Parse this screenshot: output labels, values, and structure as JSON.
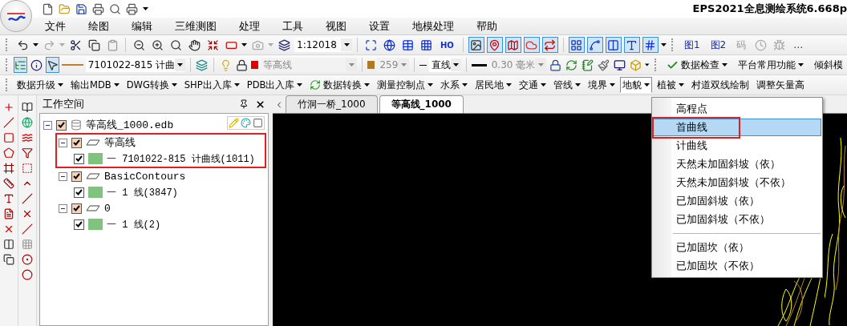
{
  "title": "EPS2021全息测绘系统6.668p",
  "menu": [
    "文件",
    "绘图",
    "编辑",
    "三维测图",
    "处理",
    "工具",
    "视图",
    "设置",
    "地模处理",
    "帮助"
  ],
  "toolbar_standard": {
    "scale": "1:12018",
    "text_button": "HO",
    "view_buttons": [
      "图1",
      "图2"
    ],
    "code_button": {
      "label": "码",
      "disabled": true
    },
    "more": "…"
  },
  "toolbar_properties": {
    "layer_tree_on": true,
    "select_on": true,
    "code": {
      "value": "7101022-815 计曲",
      "disabled": false
    },
    "layer": {
      "value": "等高线",
      "disabled": true
    },
    "color_index": {
      "value": "259",
      "disabled": true
    },
    "line_type": {
      "value": "直线",
      "disabled": false
    },
    "line_width": {
      "value": "0.30 毫米",
      "disabled": true
    },
    "menus": [
      "数据检查",
      "平台常用功能",
      "倾斜模"
    ]
  },
  "toolbar_modules": [
    {
      "label": "数据升级",
      "open": false
    },
    {
      "label": "输出MDB",
      "open": false
    },
    {
      "label": "DWG转换",
      "open": false
    },
    {
      "label": "SHP出入库",
      "open": false
    },
    {
      "label": "PDB出入库",
      "open": false
    },
    {
      "label": "数据转换",
      "open": false
    },
    {
      "label": "测量控制点",
      "open": false
    },
    {
      "label": "水系",
      "open": false
    },
    {
      "label": "居民地",
      "open": false
    },
    {
      "label": "交通",
      "open": false
    },
    {
      "label": "管线",
      "open": false
    },
    {
      "label": "境界",
      "open": false
    },
    {
      "label": "地貌",
      "open": true
    },
    {
      "label": "植被",
      "open": false
    },
    {
      "label": "村道双线绘制",
      "open": false
    },
    {
      "label": "调整矢量高",
      "open": false
    }
  ],
  "workspace": {
    "title": "工作空间",
    "tree": [
      {
        "kind": "database",
        "label": "等高线_1000.edb",
        "checked": true,
        "expanded": true,
        "highlighted": false,
        "children": [
          {
            "kind": "layer",
            "label": "等高线",
            "checked": true,
            "expanded": true,
            "highlighted": true,
            "children": [
              {
                "kind": "code",
                "label": "一 7101022-815 计曲线(1011)",
                "checked": true
              }
            ]
          },
          {
            "kind": "layer",
            "label": "BasicContours",
            "checked": true,
            "expanded": true,
            "highlighted": false,
            "children": [
              {
                "kind": "code",
                "label": "一 1 线(3847)",
                "checked": true
              }
            ]
          },
          {
            "kind": "layer",
            "label": "0",
            "checked": true,
            "expanded": true,
            "highlighted": false,
            "children": [
              {
                "kind": "code",
                "label": "一 1 线(2)",
                "checked": true
              }
            ]
          }
        ]
      }
    ]
  },
  "document_tabs": [
    {
      "label": "竹洞一桥_1000",
      "selected": false
    },
    {
      "label": "等高线_1000",
      "selected": true
    }
  ],
  "dropdown": [
    {
      "kind": "item",
      "label": "高程点",
      "selected": false,
      "annotated": false
    },
    {
      "kind": "item",
      "label": "首曲线",
      "selected": true,
      "annotated": true
    },
    {
      "kind": "item",
      "label": "计曲线",
      "selected": false,
      "annotated": false
    },
    {
      "kind": "item",
      "label": "天然未加固斜坡（依）",
      "selected": false,
      "annotated": false
    },
    {
      "kind": "item",
      "label": "天然未加固斜坡（不依）",
      "selected": false,
      "annotated": false
    },
    {
      "kind": "item",
      "label": "已加固斜坡（依）",
      "selected": false,
      "annotated": false
    },
    {
      "kind": "item",
      "label": "已加固斜坡（不依）",
      "selected": false,
      "annotated": false
    },
    {
      "kind": "separator"
    },
    {
      "kind": "item",
      "label": "已加固坎（依）",
      "selected": false,
      "annotated": false
    },
    {
      "kind": "item",
      "label": "已加固坎（不依）",
      "selected": false,
      "annotated": false
    }
  ]
}
